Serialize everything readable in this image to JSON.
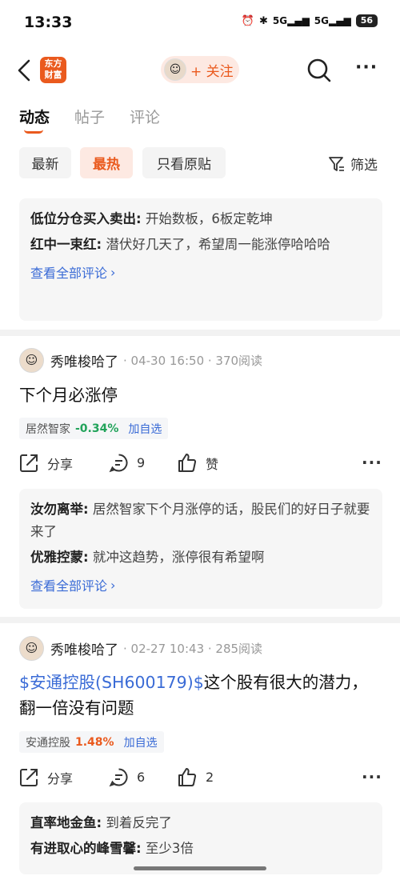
{
  "status_bar": {
    "time": "13:33",
    "alarm": "⏰",
    "bluetooth": "✱",
    "signal1": "5G",
    "signal2": "5G",
    "battery": "56"
  },
  "nav": {
    "logo_line1": "东方",
    "logo_line2": "财富",
    "follow_label": "+ 关注"
  },
  "tabs": [
    "动态",
    "帖子",
    "评论"
  ],
  "filters": {
    "latest": "最新",
    "hot": "最热",
    "original_only": "只看原贴",
    "filter": "筛选"
  },
  "top_comments": [
    {
      "name": "低位分仓买入卖出:",
      "text": " 开始数板，6板定乾坤"
    },
    {
      "name": "红中一束红:",
      "text": " 潜伏好几天了，希望周一能涨停哈哈哈"
    }
  ],
  "view_all_label": "查看全部评论",
  "posts": [
    {
      "author": "秀唯梭哈了",
      "meta": "· 04-30 16:50 · 370阅读",
      "body": "下个月必涨停",
      "stock": {
        "name": "居然智家",
        "change": "-0.34%",
        "add": "加自选"
      },
      "share_label": "分享",
      "comments_count": "9",
      "like_label": "赞",
      "comments": [
        {
          "name": "汝勿离举:",
          "text": " 居然智家下个月涨停的话，股民们的好日子就要来了"
        },
        {
          "name": "优雅控蒙:",
          "text": " 就冲这趋势，涨停很有希望啊"
        }
      ]
    },
    {
      "author": "秀唯梭哈了",
      "meta": "· 02-27 10:43 · 285阅读",
      "body_link": "$安通控股(SH600179)$",
      "body": "这个股有很大的潜力，翻一倍没有问题",
      "stock": {
        "name": "安通控股",
        "change": "1.48%",
        "add": "加自选"
      },
      "share_label": "分享",
      "comments_count": "6",
      "like_count": "2",
      "comments": [
        {
          "name": "直率地金鱼:",
          "text": " 到着反完了"
        },
        {
          "name": "有进取心的峰雪馨:",
          "text": " 至少3倍"
        }
      ]
    }
  ],
  "colors": {
    "accent": "#ea5a1e",
    "link": "#3a6bd6",
    "positive": "#ea5a1e",
    "negative": "#21a35a"
  }
}
